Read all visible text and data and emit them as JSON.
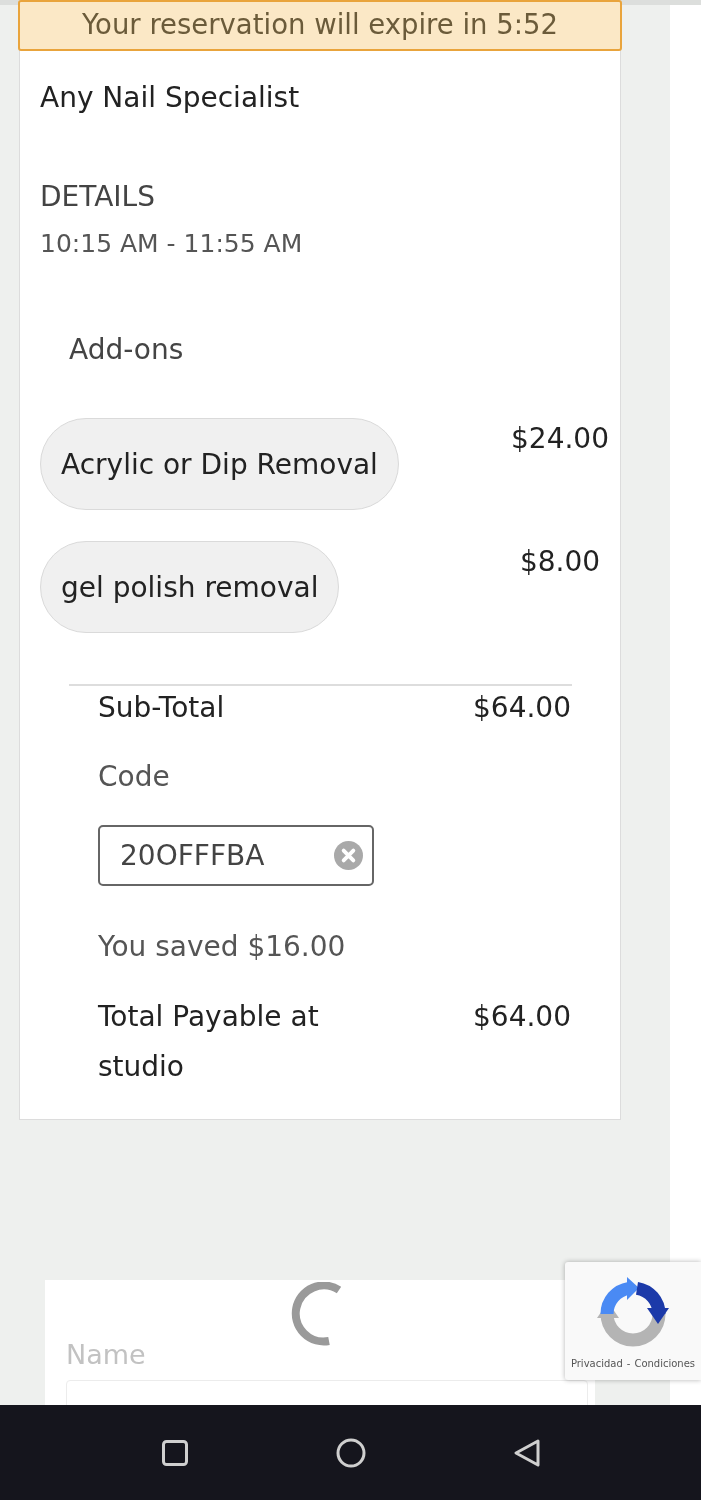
{
  "banner": {
    "text": "Your reservation will expire in 5:52"
  },
  "booking": {
    "specialist": "Any Nail Specialist",
    "details_heading": "DETAILS",
    "time": "10:15 AM - 11:55 AM"
  },
  "addons": {
    "heading": "Add-ons",
    "items": [
      {
        "name": "Acrylic or Dip Removal",
        "price": "$24.00"
      },
      {
        "name": "gel polish removal",
        "price": "$8.00"
      }
    ]
  },
  "summary": {
    "subtotal": {
      "label": "Sub-Total",
      "value": "$64.00"
    },
    "code": {
      "label": "Code",
      "value": "20OFFFBA"
    },
    "savings": "You saved $16.00",
    "total": {
      "label": "Total Payable at studio",
      "value": "$64.00"
    }
  },
  "form": {
    "loading": true,
    "fields": [
      {
        "label": "Name"
      }
    ]
  },
  "captcha_badge": {
    "privacy_link": "Privacidad",
    "separator": "-",
    "terms_link": "Condiciones"
  }
}
